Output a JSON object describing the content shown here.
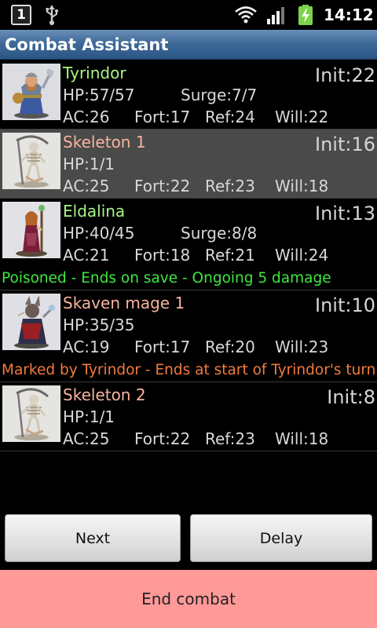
{
  "status_bar": {
    "notification_count": "1",
    "time": "14:12",
    "icons": [
      "notification-icon",
      "usb-icon",
      "wifi-icon",
      "signal-icon",
      "battery-charging-icon"
    ]
  },
  "app": {
    "title": "Combat Assistant"
  },
  "combatants": [
    {
      "name": "Tyrindor",
      "side": "ally",
      "init": "Init:22",
      "hp": "HP:57/57",
      "surge": "Surge:7/7",
      "ac": "AC:26",
      "fort": "Fort:17",
      "ref": "Ref:24",
      "will": "Will:22",
      "effect": "",
      "selected": false,
      "portrait": "dwarf-fighter-miniature"
    },
    {
      "name": "Skeleton 1",
      "side": "enemy",
      "init": "Init:16",
      "hp": "HP:1/1",
      "surge": "",
      "ac": "AC:25",
      "fort": "Fort:22",
      "ref": "Ref:23",
      "will": "Will:18",
      "effect": "",
      "selected": true,
      "portrait": "skeleton-scythe-miniature"
    },
    {
      "name": "Eldalina",
      "side": "ally",
      "init": "Init:13",
      "hp": "HP:40/45",
      "surge": "Surge:8/8",
      "ac": "AC:21",
      "fort": "Fort:18",
      "ref": "Ref:21",
      "will": "Will:24",
      "effect": "Poisoned - Ends on save - Ongoing 5 damage",
      "effect_color": "#3ee83e",
      "selected": false,
      "portrait": "elf-mage-miniature"
    },
    {
      "name": "Skaven mage 1",
      "side": "enemy",
      "init": "Init:10",
      "hp": "HP:35/35",
      "surge": "",
      "ac": "AC:19",
      "fort": "Fort:17",
      "ref": "Ref:20",
      "will": "Will:23",
      "effect": "Marked by Tyrindor - Ends at start of Tyrindor's turn",
      "effect_color": "#f27b3f",
      "selected": false,
      "portrait": "skaven-mage-miniature"
    },
    {
      "name": "Skeleton 2",
      "side": "enemy",
      "init": "Init:8",
      "hp": "HP:1/1",
      "surge": "",
      "ac": "AC:25",
      "fort": "Fort:22",
      "ref": "Ref:23",
      "will": "Will:18",
      "effect": "",
      "selected": false,
      "portrait": "skeleton-scythe-miniature"
    }
  ],
  "buttons": {
    "next": "Next",
    "delay": "Delay",
    "end_combat": "End combat"
  },
  "colors": {
    "ally_name": "#a6f586",
    "enemy_name": "#f7b49e",
    "end_bar": "#ff9a98",
    "title_bar": "#3f6a98",
    "selected_row": "#4a4a4a"
  }
}
